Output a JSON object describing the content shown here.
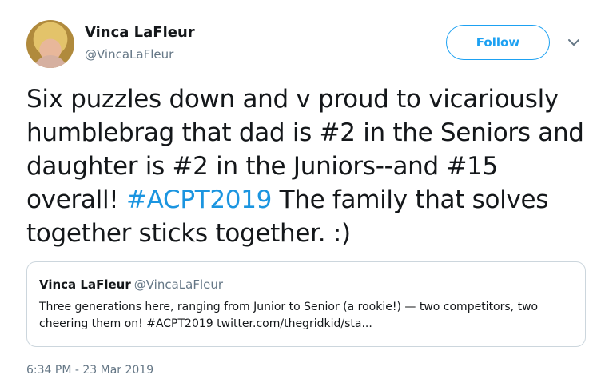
{
  "author": {
    "name": "Vinca LaFleur",
    "handle": "@VincaLaFleur"
  },
  "follow_label": "Follow",
  "tweet": {
    "text_before": "Six puzzles down and v proud to vicariously humblebrag that dad is #2 in the Seniors and daughter is #2 in the Juniors--and #15 overall! ",
    "hashtag": "#ACPT2019",
    "text_after": " The family that solves together sticks together. :)",
    "hashtag_color": "#1b95e0"
  },
  "quoted_tweet": {
    "name": "Vinca LaFleur",
    "handle": "@VincaLaFleur",
    "text": "Three generations here, ranging from Junior to Senior (a rookie!) — two competitors, two cheering them on! #ACPT2019 twitter.com/thegridkid/sta..."
  },
  "timestamp": "6:34 PM - 23 Mar 2019",
  "icons": {
    "caret": "chevron-down-icon"
  },
  "colors": {
    "accent": "#1da1f2",
    "secondary_text": "#657786",
    "border": "#ccd6dd"
  }
}
